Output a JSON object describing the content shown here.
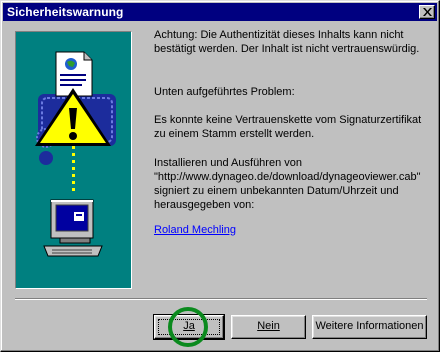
{
  "window": {
    "title": "Sicherheitswarnung"
  },
  "content": {
    "warning": "Achtung: Die Authentizität dieses Inhalts kann nicht bestätigt werden. Der Inhalt ist nicht vertrauenswürdig.",
    "problem_heading": "Unten aufgeführtes Problem:",
    "problem_text": "Es konnte keine Vertrauenskette vom Signaturzertifikat zu einem Stamm erstellt werden.",
    "install_line1": "Installieren und Ausführen von",
    "install_url": "\"http://www.dynageo.de/download/dynageoviewer.cab\"",
    "install_line3": "signiert zu einem unbekannten Datum/Uhrzeit und",
    "install_line4": "herausgegeben von:",
    "publisher_link": "Roland Mechling"
  },
  "buttons": {
    "yes": "Ja",
    "no": "Nein",
    "more_info": "Weitere Informationen"
  },
  "icons": [
    "close-icon",
    "document-icon",
    "warning-icon",
    "certificate-icon",
    "computer-icon"
  ],
  "colors": {
    "titlebar": "#000080",
    "art_background": "#008080",
    "warning_yellow": "#ffff00",
    "link": "#0000ff",
    "annotation_circle": "#0b8a1e"
  }
}
